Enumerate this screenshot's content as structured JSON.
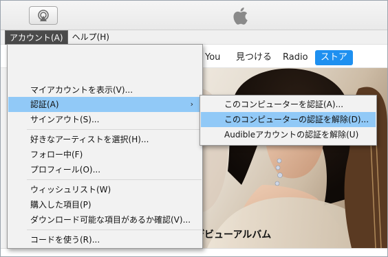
{
  "menubar": {
    "account": "アカウント(A)",
    "help": "ヘルプ(H)"
  },
  "store_nav": {
    "you": "You",
    "discover": "見つける",
    "radio": "Radio",
    "store": "ストア"
  },
  "hero": {
    "caption": "デビューアルバム"
  },
  "account_menu": {
    "items": [
      "マイアカウントを表示(V)...",
      "認証(A)",
      "サインアウト(S)...",
      "好きなアーティストを選択(H)...",
      "フォロー中(F)",
      "プロフィール(O)...",
      "ウィッシュリスト(W)",
      "購入した項目(P)",
      "ダウンロード可能な項目があるか確認(V)...",
      "コードを使う(R)..."
    ],
    "submenu_arrow": "›"
  },
  "authorize_submenu": {
    "items": [
      "このコンピューターを認証(A)...",
      "このコンピューターの認証を解除(D)...",
      "Audibleアカウントの認証を解除(U)"
    ]
  },
  "colors": {
    "highlight": "#91c9f7",
    "store_button": "#1e90f0",
    "active_menu": "#4a4a4a"
  }
}
